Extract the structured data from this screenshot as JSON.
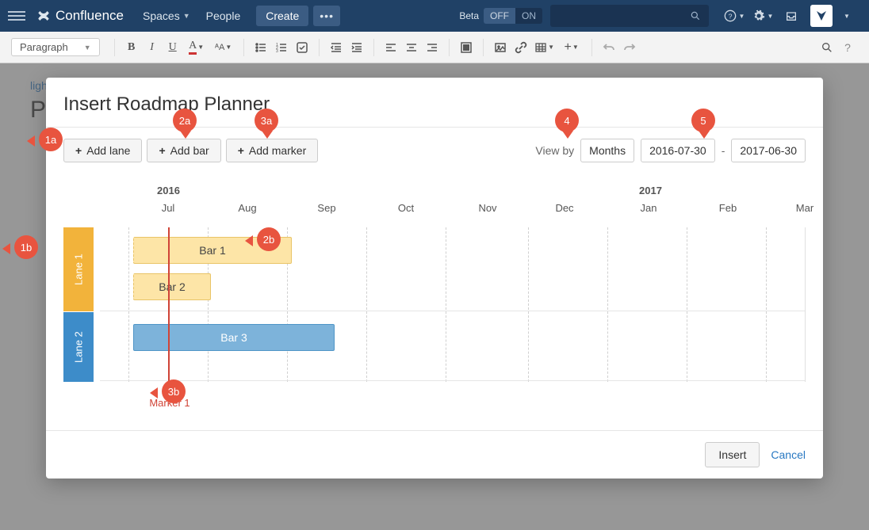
{
  "header": {
    "brand": "Confluence",
    "nav": {
      "spaces": "Spaces",
      "people": "People",
      "create": "Create"
    },
    "beta": {
      "label": "Beta",
      "off": "OFF",
      "on": "ON"
    }
  },
  "toolbar": {
    "para_style": "Paragraph"
  },
  "page": {
    "breadcrumb": "ligh",
    "title": "P"
  },
  "modal": {
    "title": "Insert Roadmap Planner",
    "buttons": {
      "add_lane": "Add lane",
      "add_bar": "Add bar",
      "add_marker": "Add marker"
    },
    "view": {
      "label": "View by",
      "unit": "Months",
      "start": "2016-07-30",
      "dash": "-",
      "end": "2017-06-30"
    },
    "footer": {
      "insert": "Insert",
      "cancel": "Cancel"
    }
  },
  "timeline": {
    "years": {
      "y2016": "2016",
      "y2017": "2017"
    },
    "months": {
      "jul": "Jul",
      "aug": "Aug",
      "sep": "Sep",
      "oct": "Oct",
      "nov": "Nov",
      "dec": "Dec",
      "jan": "Jan",
      "feb": "Feb",
      "mar": "Mar"
    },
    "lanes": {
      "lane1": "Lane 1",
      "lane2": "Lane 2"
    },
    "bars": {
      "bar1": "Bar 1",
      "bar2": "Bar 2",
      "bar3": "Bar 3"
    },
    "marker": "Marker 1"
  },
  "pins": {
    "p1a": "1a",
    "p1b": "1b",
    "p2a": "2a",
    "p2b": "2b",
    "p3a": "3a",
    "p3b": "3b",
    "p4": "4",
    "p5": "5"
  }
}
